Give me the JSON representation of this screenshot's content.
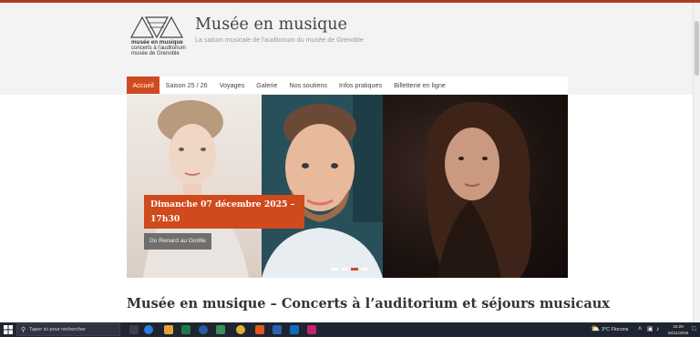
{
  "site": {
    "logo": {
      "line1": "musée en musique",
      "line2": "concerts à l'auditorium",
      "line3": "musée de Grenoble"
    },
    "title": "Musée en musique",
    "tagline": "La saison musicale de l'auditorium du musée de Grenoble"
  },
  "nav": {
    "items": [
      {
        "label": "Accueil",
        "active": true
      },
      {
        "label": "Saison 25 / 26",
        "active": false
      },
      {
        "label": "Voyages",
        "active": false
      },
      {
        "label": "Galerie",
        "active": false
      },
      {
        "label": "Nos soutiens",
        "active": false
      },
      {
        "label": "Infos pratiques",
        "active": false
      },
      {
        "label": "Billetterie en ligne",
        "active": false
      }
    ]
  },
  "hero": {
    "date_line1": "Dimanche 07 décembre 2025 –",
    "date_line2": "17h30",
    "subtitle": "Du Renard au Gorille",
    "slide_count": 4,
    "active_slide": 2
  },
  "main": {
    "heading": "Musée en musique – Concerts à l’auditorium et séjours musicaux"
  },
  "taskbar": {
    "search_placeholder": "Taper ici pour rechercher",
    "weather": "3°C Flocons",
    "time": "10:28",
    "date": "26/11/2025"
  },
  "colors": {
    "accent": "#d2491f",
    "taskbar": "#1f2530",
    "header_bg": "#f3f3f3"
  }
}
